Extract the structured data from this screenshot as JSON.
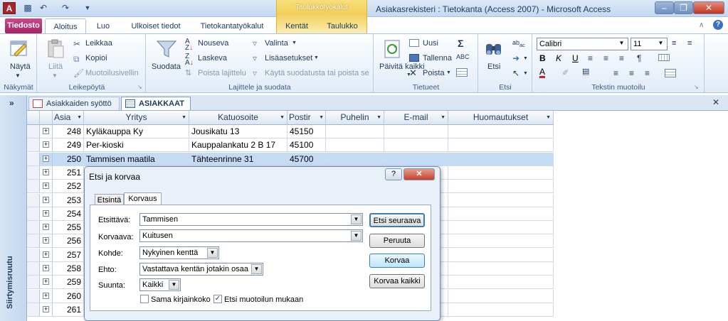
{
  "titlebar": {
    "app_icon": "A",
    "contextual_tab_group": "Taulukkotyökalut",
    "window_title": "Asiakasrekisteri : Tietokanta (Access 2007)  -  Microsoft Access",
    "controls": [
      "minimize-icon",
      "maximize-icon",
      "close-icon"
    ]
  },
  "tabs": [
    "Tiedosto",
    "Aloitus",
    "Luo",
    "Ulkoiset tiedot",
    "Tietokantatyökalut",
    "Kentät",
    "Taulukko"
  ],
  "ribbon": {
    "views": {
      "group": "Näkymät",
      "button": "Näytä"
    },
    "clipboard": {
      "group": "Leikepöytä",
      "paste": "Liitä",
      "cut": "Leikkaa",
      "copy": "Kopioi",
      "format_painter": "Muotoilusivellin"
    },
    "sort_filter": {
      "group": "Lajittele ja suodata",
      "filter": "Suodata",
      "ascending": "Nouseva",
      "descending": "Laskeva",
      "remove_sort": "Poista lajittelu",
      "selection": "Valinta",
      "advanced": "Lisäasetukset",
      "toggle_filter": "Käytä suodatusta tai poista se"
    },
    "records": {
      "group": "Tietueet",
      "refresh": "Päivitä kaikki",
      "new": "Uusi",
      "save": "Tallenna",
      "delete": "Poista",
      "totals": "Σ"
    },
    "find": {
      "group": "Etsi",
      "find": "Etsi"
    },
    "text_format": {
      "group": "Tekstin muotoilu",
      "font": "Calibri",
      "size": "11",
      "bold": "B",
      "italic": "K",
      "underline": "U",
      "font_color": "A"
    }
  },
  "navigation_pane": {
    "label": "Siirtymisruutu",
    "toggle": "»"
  },
  "doc_tabs": [
    {
      "label": "Asiakkaiden syöttö",
      "active": false
    },
    {
      "label": "ASIAKKAAT",
      "active": true
    }
  ],
  "table": {
    "columns": [
      "Asia",
      "Yritys",
      "Katuosoite",
      "Postir",
      "Puhelin",
      "E-mail",
      "Huomautukset"
    ],
    "rows": [
      {
        "id": "248",
        "company": "Kyläkauppa Ky",
        "street": "Jousikatu 13",
        "zip": "45150"
      },
      {
        "id": "249",
        "company": "Per-kioski",
        "street": "Kauppalankatu 2 B 17",
        "zip": "45100"
      },
      {
        "id": "250",
        "company": "Tammisen maatila",
        "street": "Tähteenrinne 31",
        "zip": "45700"
      },
      {
        "id": "251",
        "company": "",
        "street": "",
        "zip": ""
      },
      {
        "id": "252",
        "company": "",
        "street": "",
        "zip": ""
      },
      {
        "id": "253",
        "company": "",
        "street": "",
        "zip": ""
      },
      {
        "id": "254",
        "company": "",
        "street": "",
        "zip": ""
      },
      {
        "id": "255",
        "company": "",
        "street": "",
        "zip": ""
      },
      {
        "id": "256",
        "company": "",
        "street": "",
        "zip": ""
      },
      {
        "id": "257",
        "company": "",
        "street": "",
        "zip": ""
      },
      {
        "id": "258",
        "company": "",
        "street": "",
        "zip": ""
      },
      {
        "id": "259",
        "company": "",
        "street": "",
        "zip": ""
      },
      {
        "id": "260",
        "company": "",
        "street": "",
        "zip": ""
      },
      {
        "id": "261",
        "company": "",
        "street": "",
        "zip": ""
      }
    ],
    "selected_row": "250"
  },
  "dialog": {
    "title": "Etsi ja korvaa",
    "help": "?",
    "tabs": [
      "Etsintä",
      "Korvaus"
    ],
    "active_tab": "Korvaus",
    "find_label": "Etsittävä:",
    "find_value": "Tammisen",
    "replace_label": "Korvaava:",
    "replace_value": "Kuitusen",
    "look_in_label": "Kohde:",
    "look_in_value": "Nykyinen kenttä",
    "match_label": "Ehto:",
    "match_value": "Vastattava kentän jotakin osaa",
    "search_label": "Suunta:",
    "search_value": "Kaikki",
    "match_case_label": "Sama kirjainkoko",
    "match_case": false,
    "search_formatted_label": "Etsi muotoilun mukaan",
    "search_formatted": true,
    "buttons": {
      "find_next": "Etsi seuraava",
      "cancel": "Peruuta",
      "replace": "Korvaa",
      "replace_all": "Korvaa kaikki"
    }
  }
}
